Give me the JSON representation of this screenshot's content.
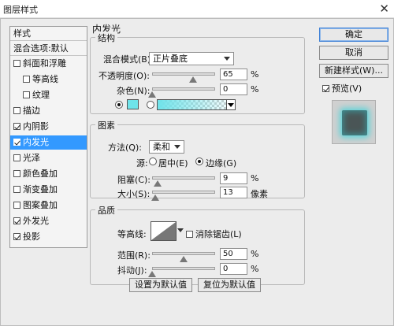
{
  "window": {
    "title": "图层样式",
    "close_glyph": "✕"
  },
  "sidebar": {
    "header": "样式",
    "blend_options": "混合选项:默认",
    "items": [
      {
        "label": "斜面和浮雕",
        "checked": false,
        "indent": false,
        "selected": false
      },
      {
        "label": "等高线",
        "checked": false,
        "indent": true,
        "selected": false
      },
      {
        "label": "纹理",
        "checked": false,
        "indent": true,
        "selected": false
      },
      {
        "label": "描边",
        "checked": false,
        "indent": false,
        "selected": false
      },
      {
        "label": "内阴影",
        "checked": true,
        "indent": false,
        "selected": false
      },
      {
        "label": "内发光",
        "checked": true,
        "indent": false,
        "selected": true
      },
      {
        "label": "光泽",
        "checked": false,
        "indent": false,
        "selected": false
      },
      {
        "label": "颜色叠加",
        "checked": false,
        "indent": false,
        "selected": false
      },
      {
        "label": "渐变叠加",
        "checked": false,
        "indent": false,
        "selected": false
      },
      {
        "label": "图案叠加",
        "checked": false,
        "indent": false,
        "selected": false
      },
      {
        "label": "外发光",
        "checked": true,
        "indent": false,
        "selected": false
      },
      {
        "label": "投影",
        "checked": true,
        "indent": false,
        "selected": false
      }
    ]
  },
  "main": {
    "section_title": "内发光",
    "structure": {
      "title": "结构",
      "blend_mode_label": "混合模式(B):",
      "blend_mode_value": "正片叠底",
      "opacity_label": "不透明度(O):",
      "opacity_value": "65",
      "opacity_fraction": 0.65,
      "noise_label": "杂色(N):",
      "noise_value": "0",
      "noise_fraction": 0,
      "percent": "%",
      "glow_color": "#6fe3ea"
    },
    "elements": {
      "title": "图素",
      "technique_label": "方法(Q):",
      "technique_value": "柔和",
      "source_label": "源:",
      "source_center": "居中(E)",
      "source_edge": "边缘(G)",
      "choke_label": "阻塞(C):",
      "choke_value": "9",
      "choke_fraction": 0.09,
      "size_label": "大小(S):",
      "size_value": "13",
      "size_fraction": 0.052,
      "percent": "%",
      "pixels": "像素"
    },
    "quality": {
      "title": "品质",
      "contour_label": "等高线:",
      "antialias_label": "消除锯齿(L)",
      "range_label": "范围(R):",
      "range_value": "50",
      "range_fraction": 0.5,
      "jitter_label": "抖动(J):",
      "jitter_value": "0",
      "jitter_fraction": 0,
      "percent": "%"
    },
    "reset_default": "设置为默认值",
    "restore_default": "复位为默认值"
  },
  "actions": {
    "ok": "确定",
    "cancel": "取消",
    "new_style": "新建样式(W)...",
    "preview": "预览(V)",
    "preview_checked": true
  }
}
